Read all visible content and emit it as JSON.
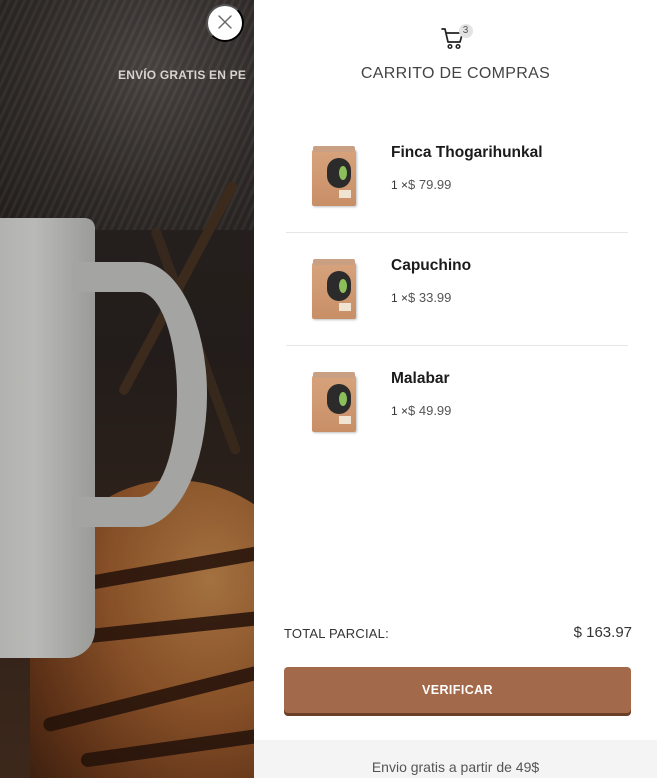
{
  "hero": {
    "promo_text": "ENVÍO GRATIS EN PE"
  },
  "icons": {
    "close": "close-icon",
    "cart": "cart-icon"
  },
  "cart": {
    "count": "3",
    "title": "CARRITO DE COMPRAS",
    "items": [
      {
        "name": "Finca Thogarihunkal",
        "qty": "1 ×",
        "price": "$ 79.99"
      },
      {
        "name": "Capuchino",
        "qty": "1 ×",
        "price": "$ 33.99"
      },
      {
        "name": "Malabar",
        "qty": "1 ×",
        "price": "$ 49.99"
      }
    ],
    "subtotal_label": "TOTAL PARCIAL:",
    "subtotal_value": "$ 163.97",
    "checkout_label": "VERIFICAR",
    "free_shipping_text": "Envio gratis a partir de 49$"
  },
  "colors": {
    "accent": "#a2694a",
    "accent_shadow": "#6b3e27",
    "drawer_bg": "#ffffff",
    "footer_bg": "#f4f4f4"
  }
}
